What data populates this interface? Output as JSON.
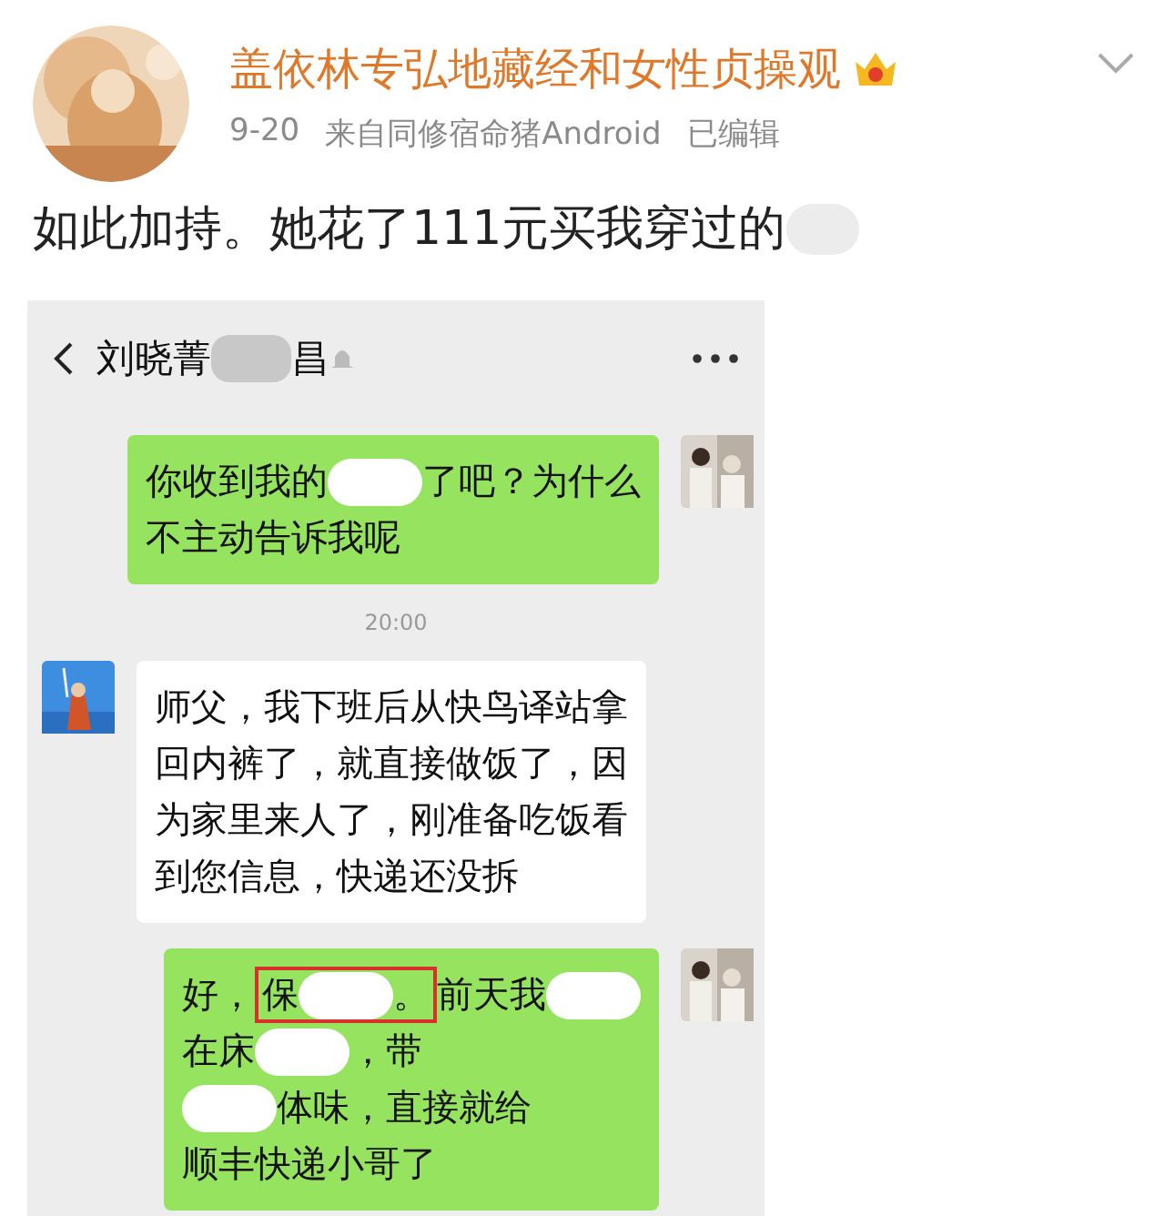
{
  "post": {
    "author": "盖依林专弘地藏经和女性贞操观",
    "date": "9-20",
    "source": "来自同修宿命猪Android",
    "edited": "已编辑",
    "text_parts": [
      {
        "kind": "text",
        "text": "如此加持。她花了111元买我穿过的"
      },
      {
        "kind": "blot"
      }
    ]
  },
  "chat": {
    "title_parts": [
      {
        "kind": "text",
        "text": "刘晓菁"
      },
      {
        "kind": "blot"
      },
      {
        "kind": "text",
        "text": "昌"
      }
    ],
    "messages": [
      {
        "kind": "sent",
        "lines": [
          [
            {
              "kind": "text",
              "text": "你收到我的"
            },
            {
              "kind": "blot"
            },
            {
              "kind": "text",
              "text": "了吧？为什么"
            }
          ],
          [
            {
              "kind": "text",
              "text": "不主动告诉我呢"
            }
          ]
        ]
      },
      {
        "kind": "time",
        "text": "20:00"
      },
      {
        "kind": "received",
        "lines": [
          [
            {
              "kind": "text",
              "text": "师父，我下班后从快鸟译站拿"
            }
          ],
          [
            {
              "kind": "text",
              "text": "回内裤了，就直接做饭了，因"
            }
          ],
          [
            {
              "kind": "text",
              "text": "为家里来人了，刚准备吃饭看"
            }
          ],
          [
            {
              "kind": "text",
              "text": "到您信息，快递还没拆"
            }
          ]
        ]
      },
      {
        "kind": "sent",
        "lines": [
          [
            {
              "kind": "text",
              "text": "好，"
            },
            {
              "kind": "boxed",
              "parts": [
                {
                  "kind": "text",
                  "text": "保"
                },
                {
                  "kind": "blot"
                },
                {
                  "kind": "text",
                  "text": "。"
                }
              ]
            },
            {
              "kind": "text",
              "text": "前天我"
            },
            {
              "kind": "blot"
            }
          ],
          [
            {
              "kind": "text",
              "text": "在床"
            },
            {
              "kind": "blot"
            },
            {
              "kind": "text",
              "text": "，带"
            }
          ],
          [
            {
              "kind": "blot"
            },
            {
              "kind": "text",
              "text": "体味，直接就给"
            }
          ],
          [
            {
              "kind": "text",
              "text": "顺丰快递小哥了"
            }
          ]
        ]
      }
    ]
  }
}
